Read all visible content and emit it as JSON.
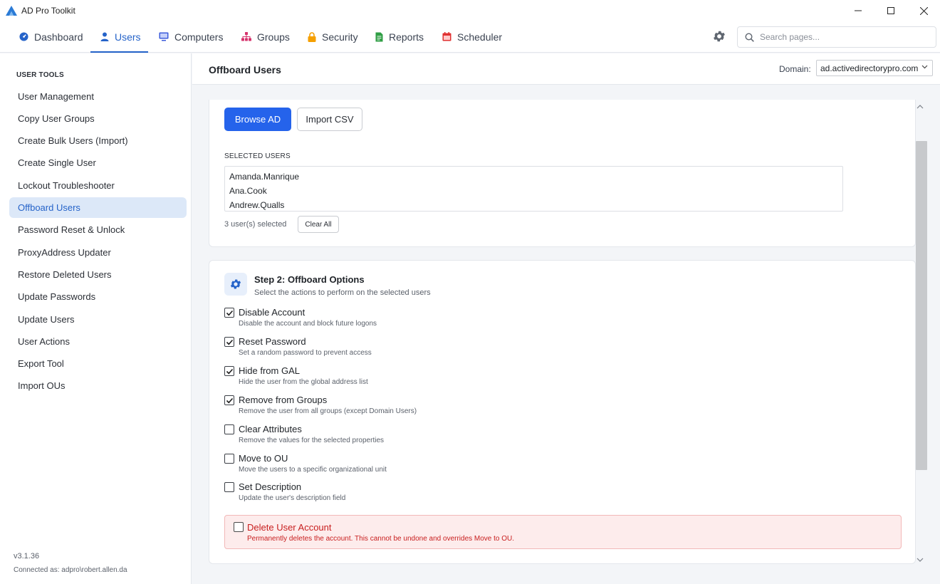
{
  "window": {
    "title": "AD Pro Toolkit",
    "logo_icon": "ad-pro-logo-icon"
  },
  "nav": {
    "tabs": [
      {
        "label": "Dashboard",
        "icon": "dashboard-icon",
        "color": "#2563c9"
      },
      {
        "label": "Users",
        "icon": "user-icon",
        "color": "#2563c9",
        "active": true
      },
      {
        "label": "Computers",
        "icon": "monitor-icon",
        "color": "#3b5bdb"
      },
      {
        "label": "Groups",
        "icon": "groups-icon",
        "color": "#d6336c"
      },
      {
        "label": "Security",
        "icon": "lock-icon",
        "color": "#f59f00"
      },
      {
        "label": "Reports",
        "icon": "report-icon",
        "color": "#2f9e44"
      },
      {
        "label": "Scheduler",
        "icon": "calendar-icon",
        "color": "#e03131"
      }
    ],
    "search_placeholder": "Search pages..."
  },
  "sidebar": {
    "heading": "USER TOOLS",
    "items": [
      {
        "label": "User Management"
      },
      {
        "label": "Copy User Groups"
      },
      {
        "label": "Create Bulk Users (Import)"
      },
      {
        "label": "Create Single User"
      },
      {
        "label": "Lockout Troubleshooter"
      },
      {
        "label": "Offboard Users",
        "active": true
      },
      {
        "label": "Password Reset & Unlock"
      },
      {
        "label": "ProxyAddress Updater"
      },
      {
        "label": "Restore Deleted Users"
      },
      {
        "label": "Update Passwords"
      },
      {
        "label": "Update Users"
      },
      {
        "label": "User Actions"
      },
      {
        "label": "Export Tool"
      },
      {
        "label": "Import OUs"
      }
    ],
    "version": "v3.1.36",
    "connected": "Connected as: adpro\\robert.allen.da"
  },
  "header": {
    "title": "Offboard Users",
    "domain_label": "Domain:",
    "domain_value": "ad.activedirectorypro.com"
  },
  "selection": {
    "browse_label": "Browse AD",
    "import_label": "Import CSV",
    "selected_label": "SELECTED USERS",
    "users": [
      "Amanda.Manrique",
      "Ana.Cook",
      "Andrew.Qualls"
    ],
    "count_text": "3 user(s) selected",
    "clear_label": "Clear All"
  },
  "options": {
    "title": "Step 2: Offboard Options",
    "subtitle": "Select the actions to perform on the selected users",
    "items": [
      {
        "title": "Disable Account",
        "desc": "Disable the account and block future logons",
        "checked": true
      },
      {
        "title": "Reset Password",
        "desc": "Set a random password to prevent access",
        "checked": true
      },
      {
        "title": "Hide from GAL",
        "desc": "Hide the user from the global address list",
        "checked": true
      },
      {
        "title": "Remove from Groups",
        "desc": "Remove the user from all groups (except Domain Users)",
        "checked": true
      },
      {
        "title": "Clear Attributes",
        "desc": "Remove the values for the selected properties",
        "checked": false
      },
      {
        "title": "Move to OU",
        "desc": "Move the users to a specific organizational unit",
        "checked": false
      },
      {
        "title": "Set Description",
        "desc": "Update the user's description field",
        "checked": false
      }
    ],
    "danger": {
      "title": "Delete User Account",
      "desc": "Permanently deletes the account. This cannot be undone and overrides Move to OU.",
      "checked": false
    }
  },
  "colors": {
    "accent": "#2563eb",
    "active_bg": "#dce8f8",
    "danger": "#c81e1e",
    "danger_bg": "#fdecec"
  }
}
